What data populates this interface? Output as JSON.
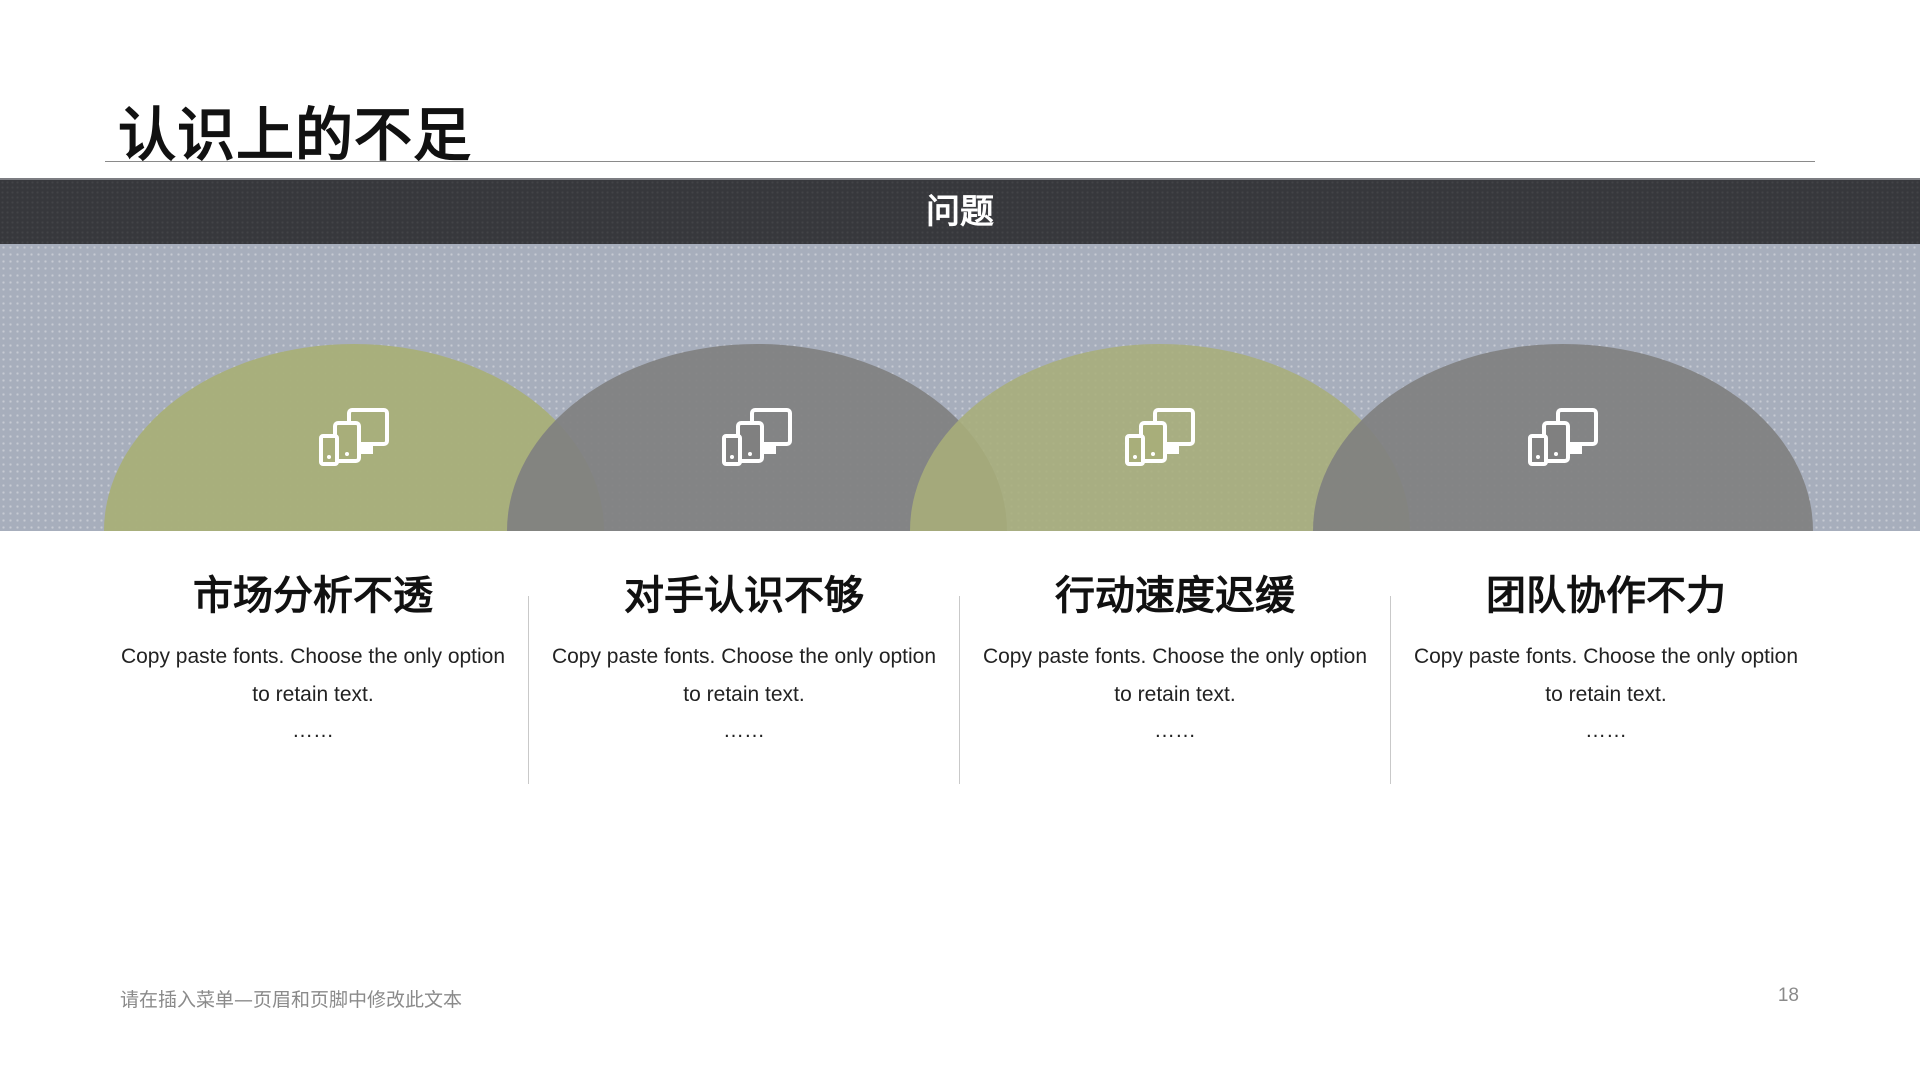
{
  "slide": {
    "title": "认识上的不足",
    "header_label": "问题",
    "colors": {
      "header_bar": "#37383c",
      "pattern_band": "#a7aebc",
      "arch_green": "#a8ae7a",
      "arch_gray": "#808080",
      "icon": "#ffffff"
    },
    "columns": [
      {
        "icon": "devices-icon",
        "heading": "市场分析不透",
        "body": "Copy paste fonts. Choose the only option to retain text.",
        "ellipsis": "……"
      },
      {
        "icon": "devices-icon",
        "heading": "对手认识不够",
        "body": "Copy paste fonts. Choose the only option to retain text.",
        "ellipsis": "……"
      },
      {
        "icon": "devices-icon",
        "heading": "行动速度迟缓",
        "body": "Copy paste fonts. Choose the only option to retain text.",
        "ellipsis": "……"
      },
      {
        "icon": "devices-icon",
        "heading": "团队协作不力",
        "body": "Copy paste fonts. Choose the only option to retain text.",
        "ellipsis": "……"
      }
    ],
    "footer_text": "请在插入菜单—页眉和页脚中修改此文本",
    "page_number": "18"
  }
}
